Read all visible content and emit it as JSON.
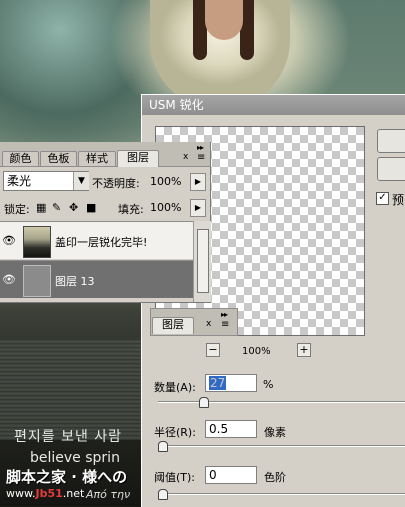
{
  "background": {
    "korean_text": "편지를 보낸 사람",
    "english_text": "believe sprin",
    "site_name": "脚本之家 · 様への",
    "site_url_prefix": "www.",
    "site_url_host": "Jb51",
    "site_url_suffix": ".net",
    "greek_text": "Από την"
  },
  "usm_dialog": {
    "title": "USM 锐化",
    "zoom_minus": "−",
    "zoom_plus": "+",
    "zoom_level": "100%",
    "preview_check": "✓",
    "preview_label": "预",
    "amount_label": "数量(A):",
    "amount_value": "27",
    "amount_unit": "%",
    "radius_label": "半径(R):",
    "radius_value": "0.5",
    "radius_unit": "像素",
    "threshold_label": "阈值(T):",
    "threshold_value": "0",
    "threshold_unit": "色阶",
    "amount_slider_fraction": 0.17,
    "radius_slider_fraction": 0.0,
    "threshold_slider_fraction": 0.0
  },
  "layers_panel": {
    "tabs": [
      "颜色",
      "色板",
      "样式",
      "图层"
    ],
    "active_tab": "图层",
    "close_glyph": "x",
    "blend_mode": "柔光",
    "opacity_label": "不透明度:",
    "opacity_value": "100%",
    "lock_label": "锁定:",
    "fill_label": "填充:",
    "fill_value": "100%",
    "layers": [
      {
        "name": "盖印一层锐化完毕!",
        "visible": true
      },
      {
        "name": "图层 13",
        "visible": true
      }
    ]
  },
  "mini_panel": {
    "tab": "图层",
    "close_glyph": "x"
  },
  "icons": {
    "eye": "eye-icon",
    "lock_transparent": "lock-transparent-icon",
    "lock_brush": "brush-icon",
    "lock_move": "move-icon",
    "lock_all": "lock-icon"
  }
}
